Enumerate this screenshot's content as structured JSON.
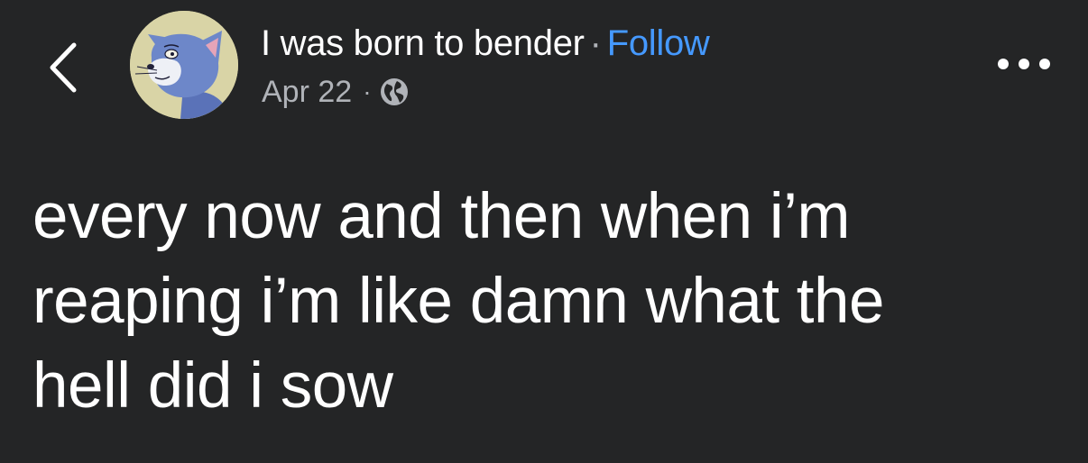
{
  "header": {
    "author_name": "I was born to bender",
    "separator": "·",
    "follow_label": "Follow",
    "date": "Apr 22",
    "meta_separator": "·",
    "audience_icon": "globe-icon",
    "back_icon": "chevron-left-icon",
    "more_icon": "more-horizontal-icon",
    "avatar_description": "cartoon-cat-avatar"
  },
  "post": {
    "text": "every now and then when i’m\nreaping i’m like damn what the\nhell did i sow"
  },
  "colors": {
    "background": "#242526",
    "text_primary": "#ffffff",
    "text_secondary": "#b0b3b8",
    "accent_link": "#4599ff"
  }
}
